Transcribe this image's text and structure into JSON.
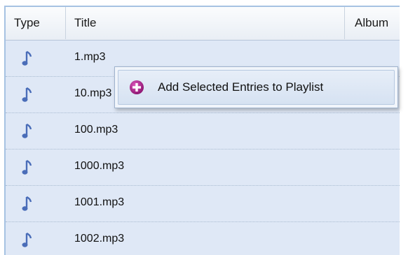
{
  "columns": {
    "type": "Type",
    "title": "Title",
    "album": "Album"
  },
  "rows": [
    {
      "icon": "music-note-icon",
      "title": "1.mp3"
    },
    {
      "icon": "music-note-icon",
      "title": "10.mp3"
    },
    {
      "icon": "music-note-icon",
      "title": "100.mp3"
    },
    {
      "icon": "music-note-icon",
      "title": "1000.mp3"
    },
    {
      "icon": "music-note-icon",
      "title": "1001.mp3"
    },
    {
      "icon": "music-note-icon",
      "title": "1002.mp3"
    }
  ],
  "context_menu": {
    "items": [
      {
        "icon": "add-circle-icon",
        "label": "Add Selected Entries to Playlist"
      }
    ]
  },
  "colors": {
    "row_background": "#dfe8f6",
    "icon_color": "#4a6db8",
    "add_icon_color": "#b0218f"
  }
}
